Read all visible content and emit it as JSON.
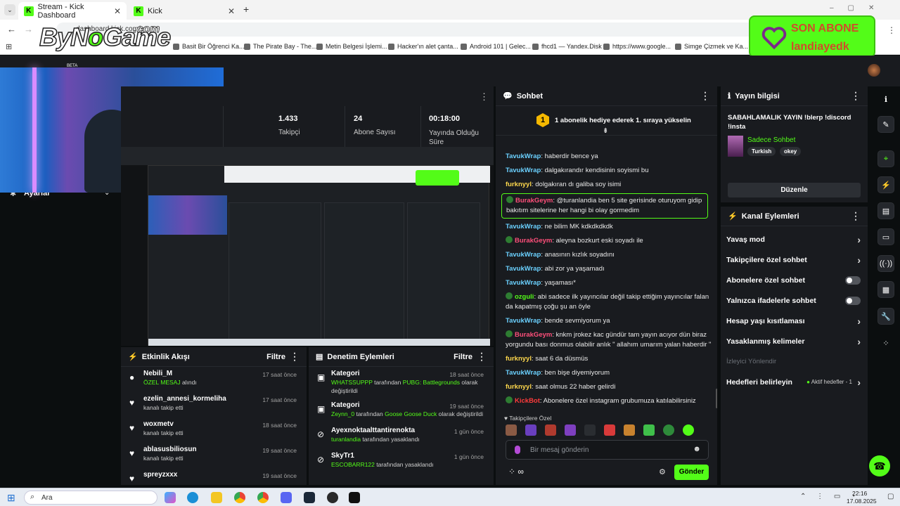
{
  "browser": {
    "tabs": [
      {
        "title": "Stream - Kick Dashboard",
        "active": true
      },
      {
        "title": "Kick",
        "active": false
      }
    ],
    "new_tab": "+",
    "url": "dashboard.kick.com/s",
    "bookmarks": [
      "Basit Bir Öğrenci Ka...",
      "The Pirate Bay - The...",
      "Metin Belgesi İşlemi...",
      "Hacker'ın alet çanta...",
      "Android 101 | Gelec...",
      "fhcd1 — Yandex.Disk",
      "https://www.google...",
      "Simge Çizmek ve Ka..."
    ]
  },
  "watermark": {
    "by": "By",
    "n": "N",
    "o": "o",
    "game": "Game",
    "com": ".com"
  },
  "son_abone": {
    "title": "SON ABONE",
    "name": "landiayedk"
  },
  "kick": {
    "beta": "BETA",
    "sidebar_settings": "Ayarlar"
  },
  "stats": {
    "panel_menu": "⋮",
    "items": [
      {
        "value": "1.433",
        "label": "Takipçi"
      },
      {
        "value": "24",
        "label": "Abone Sayısı"
      },
      {
        "value": "00:18:00",
        "label": "Yayında Olduğu Süre"
      }
    ]
  },
  "chat": {
    "title": "Sohbet",
    "pinned": "1 abonelik hediye ederek 1. sıraya yükselin",
    "messages": [
      {
        "user": "TavukWrap",
        "cls": "uw",
        "badge": false,
        "text": ": haberdir bence ya"
      },
      {
        "user": "TavukWrap",
        "cls": "uw",
        "badge": false,
        "text": ": dalgakırandır kendisinin soyismi bu"
      },
      {
        "user": "furknyyl",
        "cls": "uf",
        "badge": false,
        "text": ": dolgakıran dı galiba soy isimi"
      },
      {
        "user": "BurakGeym",
        "cls": "up",
        "badge": true,
        "text": ": @turanlandia ben 5 site gerisinde oturuyom gidip bakıtım sitelerine her hangi bi olay gormedim",
        "highlight": true
      },
      {
        "user": "TavukWrap",
        "cls": "uw",
        "badge": false,
        "text": ": ne bilim MK kdkdkdkdk"
      },
      {
        "user": "BurakGeym",
        "cls": "up",
        "badge": true,
        "text": ": aleyna bozkurt eski soyadı ile"
      },
      {
        "user": "TavukWrap",
        "cls": "uw",
        "badge": false,
        "text": ": anasının kızlık soyadını"
      },
      {
        "user": "TavukWrap",
        "cls": "uw",
        "badge": false,
        "text": ": abi zor ya yaşamadı"
      },
      {
        "user": "TavukWrap",
        "cls": "uw",
        "badge": false,
        "text": ": yaşaması*"
      },
      {
        "user": "ozguli",
        "cls": "ug",
        "badge": true,
        "text": ": abi sadece ilk yayıncılar değil takip ettiğim yayıncılar falan da kapatmış çoğu şu an öyle"
      },
      {
        "user": "TavukWrap",
        "cls": "uw",
        "badge": false,
        "text": ": bende sevmiyorum ya"
      },
      {
        "user": "BurakGeym",
        "cls": "up",
        "badge": true,
        "text": ": knkm jrokez kac gündür tam yayın acıyor dün biraz yorgundu bası donmus olabilir anlık \" allahım umarım yalan haberdir \""
      },
      {
        "user": "furknyyl",
        "cls": "uf",
        "badge": false,
        "text": ": saat 6 da düsmüs"
      },
      {
        "user": "TavukWrap",
        "cls": "uw",
        "badge": false,
        "text": ": ben bişe diyemiyorum"
      },
      {
        "user": "furknyyl",
        "cls": "uf",
        "badge": false,
        "text": ": saat olmus 22 haber gelirdi"
      },
      {
        "user": "KickBot",
        "cls": "ur",
        "badge": true,
        "text": ": Abonelere özel instagram grubumuza katılabilirsiniz"
      }
    ],
    "emote_label": "Takipçilere Özel",
    "input_placeholder": "Bir mesaj gönderin",
    "send": "Gönder"
  },
  "stream_info": {
    "title": "Yayın bilgisi",
    "stream_title": "SABAHLAMALIK YAYIN !blerp !discord !insta",
    "category": "Sadece Sohbet",
    "tags": [
      "Turkish",
      "okey"
    ],
    "edit": "Düzenle"
  },
  "channel_actions": {
    "title": "Kanal Eylemleri",
    "rows": [
      {
        "label": "Yavaş mod",
        "type": "chevron"
      },
      {
        "label": "Takipçilere özel sohbet",
        "type": "chevron"
      },
      {
        "label": "Abonelere özel sohbet",
        "type": "toggle"
      },
      {
        "label": "Yalnızca ifadelerle sohbet",
        "type": "toggle"
      },
      {
        "label": "Hesap yaşı kısıtlaması",
        "type": "chevron"
      },
      {
        "label": "Yasaklanmış kelimeler",
        "type": "chevron"
      }
    ],
    "section": "İzleyici Yönlendir",
    "goals_label": "Hedefleri belirleyin",
    "goals_value": "Aktif hedefler - 1"
  },
  "events": {
    "title": "Etkinlik Akışı",
    "filter": "Filtre",
    "items": [
      {
        "name": "Nebili_M",
        "sub_green": "ÖZEL MESAJ",
        "sub": " alındı",
        "time": "17 saat önce"
      },
      {
        "name": "ezelin_annesi_kormeliha",
        "sub_green": "",
        "sub": "kanalı takip etti",
        "time": "17 saat önce"
      },
      {
        "name": "woxmetv",
        "sub_green": "",
        "sub": "kanalı takip etti",
        "time": "18 saat önce"
      },
      {
        "name": "ablasusbiliosun",
        "sub_green": "",
        "sub": "kanalı takip etti",
        "time": "19 saat önce"
      },
      {
        "name": "spreyzxxx",
        "sub_green": "",
        "sub": "",
        "time": "19 saat önce"
      }
    ]
  },
  "moderation": {
    "title": "Denetim Eylemleri",
    "filter": "Filtre",
    "items": [
      {
        "name": "Kategori",
        "l1a": "WHATSSUPPP",
        "l1b": " tarafından ",
        "l1c": "PUBG: Battlegrounds",
        "l1d": " olarak",
        "l2": "değiştirildi",
        "time": "18 saat önce"
      },
      {
        "name": "Kategori",
        "l1a": "Zeynn_0",
        "l1b": " tarafından ",
        "l1c": "Goose Goose Duck",
        "l1d": " olarak değiştirildi",
        "l2": "",
        "time": "19 saat önce"
      },
      {
        "name": "Ayexnoktaalttantirenokta",
        "l1a": "turanlandia",
        "l1b": " tarafından yasaklandı",
        "l1c": "",
        "l1d": "",
        "l2": "",
        "time": "1 gün önce"
      },
      {
        "name": "SkyTr1",
        "l1a": "ESCOBARR122",
        "l1b": " tarafından yasaklandı",
        "l1c": "",
        "l1d": "",
        "l2": "",
        "time": "1 gün önce"
      }
    ]
  },
  "taskbar": {
    "search": "Ara",
    "time": "22:16",
    "date": "17.08.2025"
  },
  "colors": {
    "accent": "#53fc18",
    "panel": "#191b1f",
    "bg": "#0b0e0f"
  }
}
